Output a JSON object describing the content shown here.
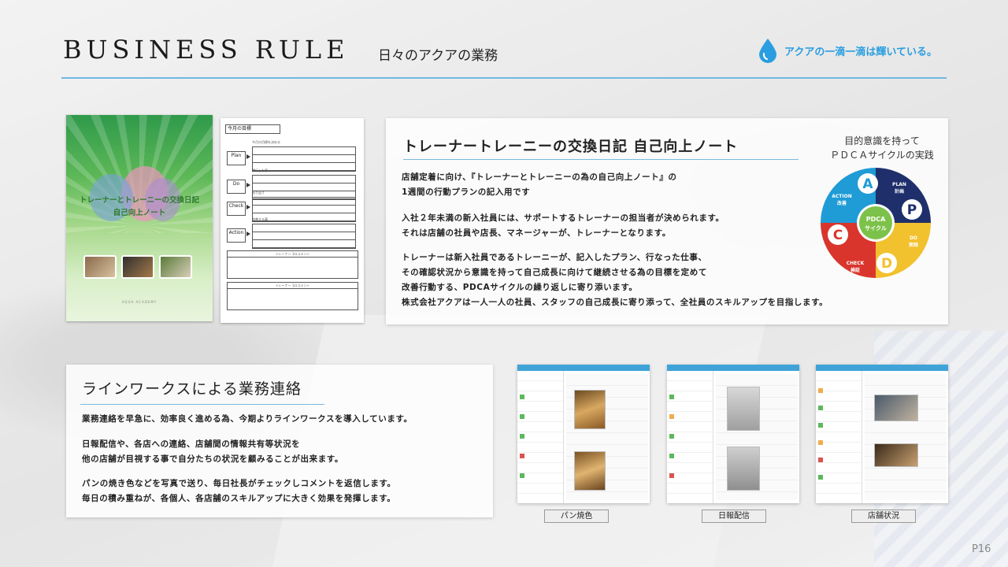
{
  "header": {
    "title": "BUSINESS RULE",
    "subtitle": "日々のアクアの業務",
    "tagline": "アクアの一滴一滴は輝いている。",
    "accent_color": "#2a9ee0",
    "icon": "water-drop-icon"
  },
  "notebook": {
    "cover_title": "トレーナーとトレーニーの交換日記",
    "cover_subtitle": "自己向上ノート",
    "cover_footer": "AQUA ACADEMY",
    "form_header": "今月の目標",
    "form_rows": [
      {
        "label": "Plan",
        "question": "今月の目標を決める"
      },
      {
        "label": "Do",
        "question": "実行した事"
      },
      {
        "label": "Check",
        "question": "振り返り"
      },
      {
        "label": "Action",
        "question": "改善する事"
      }
    ],
    "form_boxes": [
      "トレーナー 1口コメント",
      "トレーナー 1口コメント"
    ]
  },
  "diary": {
    "title": "トレーナートレーニーの交換日記 自己向上ノート",
    "lines": [
      "店舗定着に向け、『トレーナーとトレーニーの為の自己向上ノート』の",
      "1週間の行動プランの記入用です",
      "入社２年未満の新入社員には、サポートするトレーナーの担当者が決められます。",
      "それは店舗の社員や店長、マネージャーが、トレーナーとなります。",
      "トレーナーは新入社員であるトレーニーが、記入したプラン、行なった仕事、",
      "その確認状況から意識を持って自己成長に向けて継続させる為の目標を定めて",
      "改善行動する、PDCAサイクルの繰り返しに寄り添います。",
      "株式会社アクアは一人一人の社員、スタッフの自己成長に寄り添って、全社員のスキルアップを目指します。"
    ]
  },
  "pdca": {
    "caption_line1": "目的意識を持って",
    "caption_line2": "ＰＤＣＡサイクルの実践",
    "center_line1": "PDCA",
    "center_line2": "サイクル",
    "segments": [
      {
        "letter": "A",
        "name": "ACTION",
        "jp": "改善",
        "color": "#1f9bd6"
      },
      {
        "letter": "P",
        "name": "PLAN",
        "jp": "計画",
        "color": "#1e2f6b"
      },
      {
        "letter": "D",
        "name": "DO",
        "jp": "実践",
        "color": "#f2c12e"
      },
      {
        "letter": "C",
        "name": "CHECK",
        "jp": "検証",
        "color": "#d9352d"
      }
    ]
  },
  "lineworks": {
    "title": "ラインワークスによる業務連絡",
    "lines": [
      "業務連絡を早急に、効率良く進める為、今期よりラインワークスを導入しています。",
      "日報配信や、各店への連絡、店舗間の情報共有等状況を",
      "他の店舗が目視する事で自分たちの状況を顧みることが出来ます。",
      "パンの焼き色などを写真で送り、毎日社長がチェックしコメントを返信します。",
      "毎日の積み重ねが、各個人、各店舗のスキルアップに大きく効果を発揮します。"
    ]
  },
  "screenshots": [
    {
      "caption": "パン焼色"
    },
    {
      "caption": "日報配信"
    },
    {
      "caption": "店舗状況"
    }
  ],
  "page_number": "P16"
}
